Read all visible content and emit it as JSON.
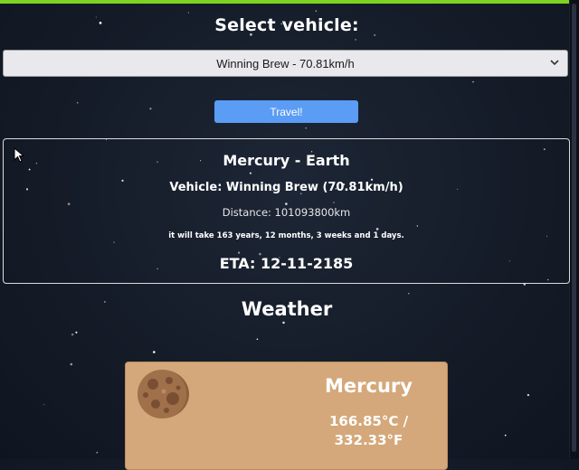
{
  "header": {
    "select_title": "Select vehicle:",
    "vehicle_selected": "Winning Brew - 70.81km/h",
    "travel_label": "Travel!"
  },
  "trip": {
    "route": "Mercury - Earth",
    "vehicle": "Vehicle: Winning Brew (70.81km/h)",
    "distance": "Distance: 101093800km",
    "duration": "it will take 163 years, 12 months, 3 weeks and 1 days.",
    "eta": "ETA: 12-11-2185"
  },
  "weather": {
    "title": "Weather",
    "planet": {
      "name": "Mercury",
      "temp_c": "166.85°C /",
      "temp_f": "332.33°F"
    }
  },
  "colors": {
    "accent_bar": "#7ed321",
    "button": "#5b9cf5",
    "planet_card": "#d4a87a",
    "background": "#141b27"
  },
  "icons": [
    "chevron-down-icon",
    "mercury-planet-icon",
    "mouse-cursor-icon"
  ]
}
